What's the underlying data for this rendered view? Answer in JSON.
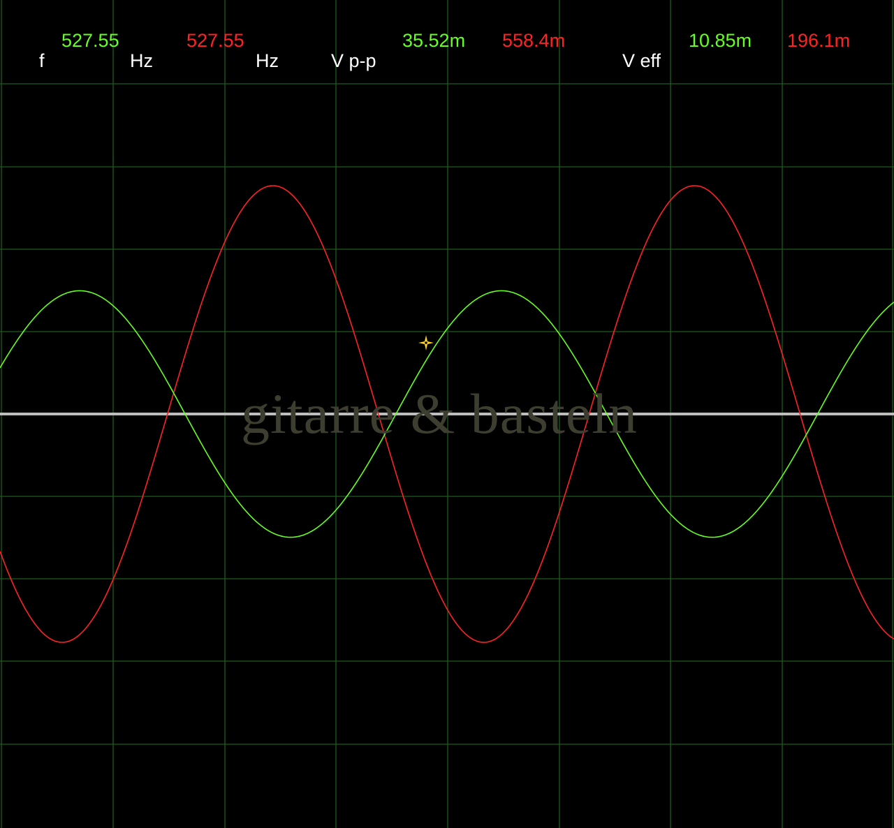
{
  "readouts": {
    "freq_label": "f",
    "freq_ch1": "527.55",
    "freq_unit_1": "Hz",
    "freq_ch2": "527.55",
    "freq_unit_2": "Hz",
    "vpp_label": "V p-p",
    "vpp_ch1": "35.52m",
    "vpp_ch2": "558.4m",
    "veff_label": "V eff",
    "veff_ch1": "10.85m",
    "veff_ch2": "196.1m"
  },
  "watermark": "gitarre & basteln",
  "colors": {
    "background": "#000000",
    "grid": "#1d5c1d",
    "baseline": "#bdbdbd",
    "channel1": "#66ff22",
    "channel2": "#ff2222",
    "cursor": "#ffd21f"
  },
  "traces": {
    "channel1": {
      "amplitude_divisions": 1.49,
      "periods_visible": 2.12,
      "phase_deg": 22
    },
    "channel2": {
      "amplitude_divisions": 2.76,
      "periods_visible": 2.12,
      "phase_deg": 217
    }
  },
  "cursor_icon": "crosshair-cursor-icon"
}
